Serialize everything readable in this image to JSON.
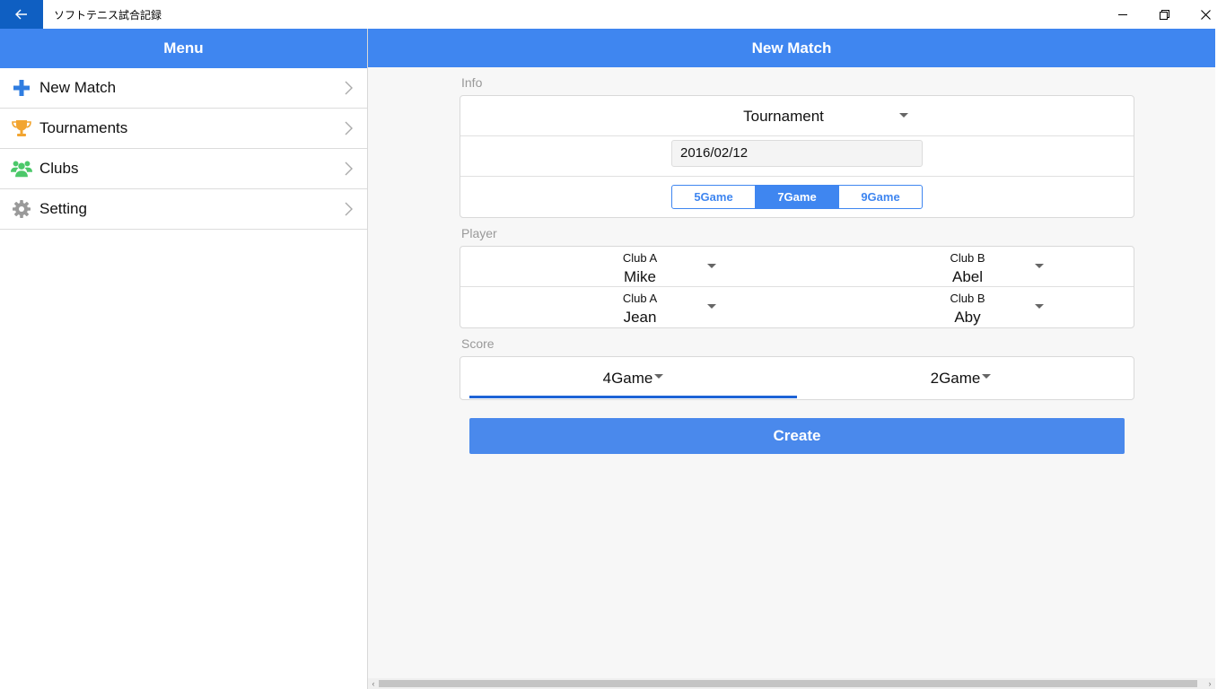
{
  "window": {
    "title": "ソフトテニス試合記録",
    "back_icon": "back-arrow-icon",
    "minimize_icon": "minimize-icon",
    "restore_icon": "restore-icon",
    "close_icon": "close-icon"
  },
  "menu": {
    "header": "Menu",
    "items": [
      {
        "label": "New Match",
        "icon": "plus-icon",
        "color": "#2f7de1"
      },
      {
        "label": "Tournaments",
        "icon": "trophy-icon",
        "color": "#f2a531"
      },
      {
        "label": "Clubs",
        "icon": "group-icon",
        "color": "#4cc86a"
      },
      {
        "label": "Setting",
        "icon": "gear-icon",
        "color": "#9a9a9a"
      }
    ]
  },
  "main": {
    "header": "New Match",
    "info": {
      "label": "Info",
      "tournament": "Tournament",
      "date": "2016/02/12",
      "games": [
        "5Game",
        "7Game",
        "9Game"
      ],
      "selected_game": "7Game"
    },
    "player": {
      "label": "Player",
      "rows": [
        {
          "left": {
            "club": "Club A",
            "name": "Mike"
          },
          "right": {
            "club": "Club B",
            "name": "Abel"
          }
        },
        {
          "left": {
            "club": "Club A",
            "name": "Jean"
          },
          "right": {
            "club": "Club B",
            "name": "Aby"
          }
        }
      ]
    },
    "score": {
      "label": "Score",
      "left": "4Game",
      "right": "2Game"
    },
    "create_label": "Create"
  },
  "colors": {
    "accent": "#3f86f0",
    "titlebar_back": "#0f5fc2",
    "score_underline": "#1e63d6"
  }
}
